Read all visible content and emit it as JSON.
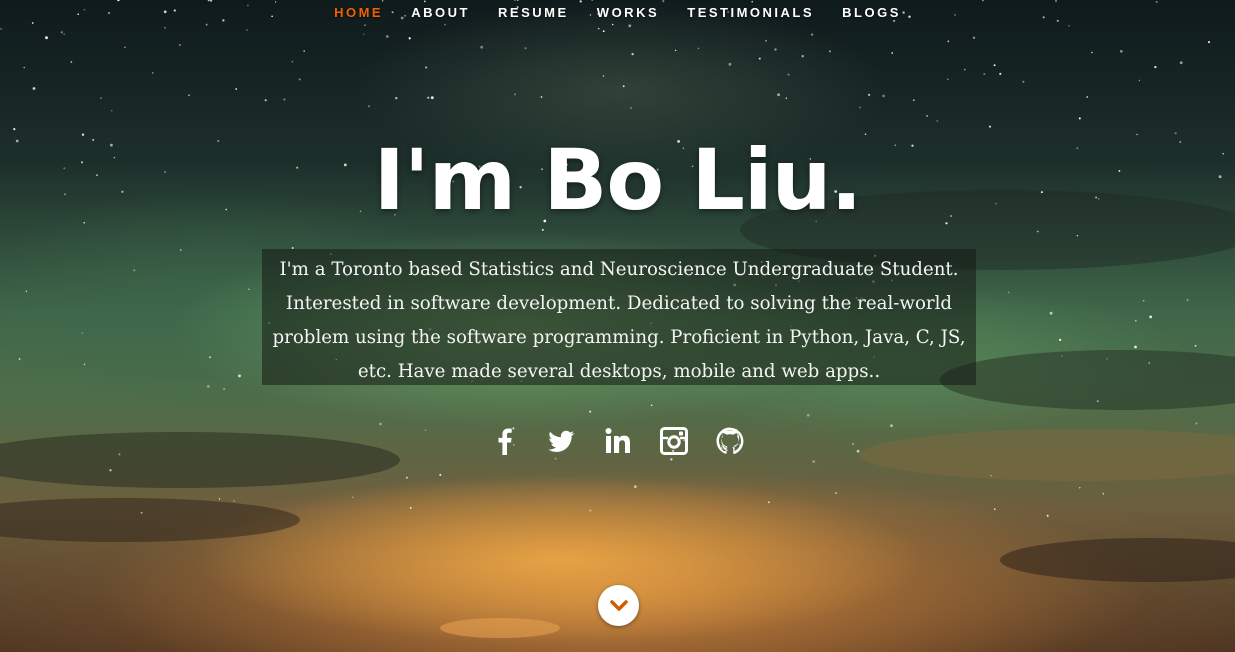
{
  "nav": {
    "items": [
      {
        "label": "HOME",
        "active": true
      },
      {
        "label": "ABOUT"
      },
      {
        "label": "RESUME"
      },
      {
        "label": "WORKS"
      },
      {
        "label": "TESTIMONIALS"
      },
      {
        "label": "BLOGS"
      }
    ]
  },
  "hero": {
    "headline": "I'm Bo Liu.",
    "intro": "I'm a Toronto based Statistics and Neuroscience Undergraduate Student. Interested in software development. Dedicated to solving the real-world problem using the software programming. Proficient in Python, Java, C, JS, etc. Have made several desktops, mobile and web apps.."
  },
  "social": {
    "icons": [
      "facebook-icon",
      "twitter-icon",
      "linkedin-icon",
      "instagram-icon",
      "github-icon"
    ]
  },
  "scroll": {
    "icon": "chevron-down-icon"
  },
  "colors": {
    "accent": "#f06000",
    "text": "#ffffff",
    "intro_background": "rgba(20,25,20,0.55)"
  }
}
